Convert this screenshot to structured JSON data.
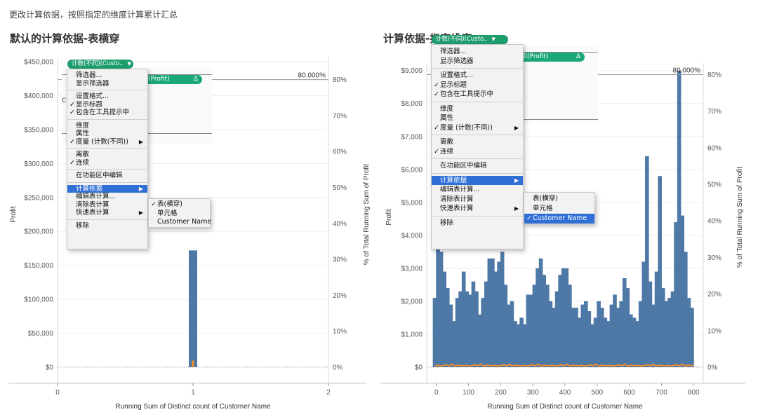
{
  "page": {
    "caption": "更改计算依据，按照指定的维度计算累计汇总",
    "left_title": "默认的计算依据-表横穿",
    "right_title": "计算依据-指定维度"
  },
  "colors": {
    "bar": "#4e79a7",
    "line": "#f28e2b",
    "pill": "#1e9d6d",
    "highlight": "#2f6fd6"
  },
  "left_panel": {
    "pill_label": "计数(不同)(Custo..",
    "pill2_label": "和(Profit)",
    "pill2_delta": "Δ",
    "partial_text": "CO",
    "ref_line_label": "80.000%",
    "menu": {
      "items": [
        {
          "label": "筛选器...",
          "checked": false,
          "submenu": false
        },
        {
          "label": "显示筛选器",
          "checked": false,
          "submenu": false
        },
        {
          "label": "设置格式...",
          "checked": false,
          "submenu": false
        },
        {
          "label": "显示标题",
          "checked": true,
          "submenu": false
        },
        {
          "label": "包含在工具提示中",
          "checked": true,
          "submenu": false
        },
        {
          "label": "维度",
          "checked": false,
          "submenu": false
        },
        {
          "label": "属性",
          "checked": false,
          "submenu": false
        },
        {
          "label": "度量 (计数(不同))",
          "checked": true,
          "submenu": true
        },
        {
          "label": "离散",
          "checked": false,
          "submenu": false
        },
        {
          "label": "连续",
          "checked": true,
          "submenu": false
        },
        {
          "label": "在功能区中编辑",
          "checked": false,
          "submenu": false
        },
        {
          "label": "计算依据",
          "checked": false,
          "submenu": true,
          "highlighted": true
        },
        {
          "label": "编辑表计算...",
          "checked": false,
          "submenu": false
        },
        {
          "label": "清除表计算",
          "checked": false,
          "submenu": false
        },
        {
          "label": "快速表计算",
          "checked": false,
          "submenu": true
        },
        {
          "label": "移除",
          "checked": false,
          "submenu": false
        }
      ],
      "submenu": [
        {
          "label": "表(横穿)",
          "checked": true,
          "highlighted": false
        },
        {
          "label": "单元格",
          "checked": false,
          "highlighted": false
        },
        {
          "label": "Customer Name",
          "checked": false,
          "highlighted": false
        }
      ]
    }
  },
  "right_panel": {
    "pill_label": "计数(不同)(Custo..",
    "pill2_label": "和(Profit)",
    "pill2_delta": "Δ",
    "ref_line_label": "80.000%",
    "menu": {
      "items": [
        {
          "label": "筛选器...",
          "checked": false,
          "submenu": false
        },
        {
          "label": "显示筛选器",
          "checked": false,
          "submenu": false
        },
        {
          "label": "设置格式...",
          "checked": false,
          "submenu": false
        },
        {
          "label": "显示标题",
          "checked": true,
          "submenu": false
        },
        {
          "label": "包含在工具提示中",
          "checked": true,
          "submenu": false
        },
        {
          "label": "维度",
          "checked": false,
          "submenu": false
        },
        {
          "label": "属性",
          "checked": false,
          "submenu": false
        },
        {
          "label": "度量 (计数(不同))",
          "checked": true,
          "submenu": true
        },
        {
          "label": "离散",
          "checked": false,
          "submenu": false
        },
        {
          "label": "连续",
          "checked": true,
          "submenu": false
        },
        {
          "label": "在功能区中编辑",
          "checked": false,
          "submenu": false
        },
        {
          "label": "计算依据",
          "checked": false,
          "submenu": true,
          "highlighted": true
        },
        {
          "label": "编辑表计算...",
          "checked": false,
          "submenu": false
        },
        {
          "label": "清除表计算",
          "checked": false,
          "submenu": false
        },
        {
          "label": "快速表计算",
          "checked": false,
          "submenu": true
        },
        {
          "label": "移除",
          "checked": false,
          "submenu": false
        }
      ],
      "submenu": [
        {
          "label": "表(横穿)",
          "checked": false,
          "highlighted": false
        },
        {
          "label": "单元格",
          "checked": false,
          "highlighted": false
        },
        {
          "label": "Customer Name",
          "checked": true,
          "highlighted": true
        }
      ]
    }
  },
  "chart_data": [
    {
      "type": "bar",
      "title": "默认的计算依据-表横穿",
      "xlabel": "Running Sum of Distinct count of Customer Name",
      "ylabel": "Profit",
      "y2label": "% of Total Running Sum of Profit",
      "xlim": [
        0,
        2
      ],
      "ylim": [
        0,
        450000
      ],
      "y2lim": [
        0,
        0.85
      ],
      "x_ticks": [
        "0",
        "1",
        "2"
      ],
      "y_ticks": [
        "$450,000",
        "$400,000",
        "$350,000",
        "$300,000",
        "$250,000",
        "$200,000",
        "$150,000",
        "$100,000",
        "$50,000",
        "$0"
      ],
      "y_tick_values": [
        450000,
        400000,
        350000,
        300000,
        250000,
        200000,
        150000,
        100000,
        50000,
        0
      ],
      "y2_ticks": [
        "80%",
        "70%",
        "60%",
        "50%",
        "40%",
        "30%",
        "20%",
        "10%",
        "0%"
      ],
      "y2_tick_values": [
        0.8,
        0.7,
        0.6,
        0.5,
        0.4,
        0.3,
        0.2,
        0.1,
        0
      ],
      "reference_line": {
        "value": 0.8,
        "label": "80.000%"
      },
      "series": [
        {
          "name": "Profit",
          "x": [
            1
          ],
          "values": [
            172000
          ]
        },
        {
          "name": "% of Total Running Sum of Profit",
          "x": [
            1
          ],
          "values": [
            10000
          ]
        }
      ]
    },
    {
      "type": "bar",
      "title": "计算依据-指定维度",
      "xlabel": "Running Sum of Distinct count of Customer Name",
      "ylabel": "Profit",
      "y2label": "% of Total Running Sum of Profit",
      "xlim": [
        -30,
        830
      ],
      "ylim": [
        0,
        9100
      ],
      "y2lim": [
        0,
        0.82
      ],
      "x_ticks": [
        "0",
        "100",
        "200",
        "300",
        "400",
        "500",
        "600",
        "700",
        "800"
      ],
      "x_tick_values": [
        0,
        100,
        200,
        300,
        400,
        500,
        600,
        700,
        800
      ],
      "y_ticks": [
        "$9,000",
        "$8,000",
        "$7,000",
        "$6,000",
        "$5,000",
        "$4,000",
        "$3,000",
        "$2,000",
        "$1,000",
        "$0"
      ],
      "y_tick_values": [
        9000,
        8000,
        7000,
        6000,
        5000,
        4000,
        3000,
        2000,
        1000,
        0
      ],
      "y2_ticks": [
        "80%",
        "70%",
        "60%",
        "50%",
        "40%",
        "30%",
        "20%",
        "10%",
        "0%"
      ],
      "y2_tick_values": [
        0.8,
        0.7,
        0.6,
        0.5,
        0.4,
        0.3,
        0.2,
        0.1,
        0
      ],
      "reference_line": {
        "value": 0.8,
        "label": "80.000%"
      },
      "series": [
        {
          "name": "Profit",
          "x": [
            -5,
            5,
            15,
            25,
            35,
            45,
            55,
            65,
            75,
            85,
            95,
            105,
            115,
            125,
            135,
            145,
            155,
            165,
            175,
            185,
            195,
            205,
            215,
            225,
            235,
            245,
            255,
            265,
            275,
            285,
            295,
            305,
            315,
            325,
            335,
            345,
            355,
            365,
            375,
            385,
            395,
            405,
            415,
            425,
            435,
            445,
            455,
            465,
            475,
            485,
            495,
            505,
            515,
            525,
            535,
            545,
            555,
            565,
            575,
            585,
            595,
            605,
            615,
            625,
            635,
            645,
            655,
            665,
            675,
            685,
            695,
            705,
            715,
            725,
            735,
            745,
            755,
            765,
            775,
            785,
            795
          ],
          "values": [
            2100,
            4100,
            3500,
            2900,
            2400,
            1900,
            1400,
            2100,
            2300,
            2900,
            2300,
            2200,
            2600,
            2300,
            1600,
            2100,
            2600,
            3300,
            3300,
            2900,
            3200,
            3500,
            2500,
            1900,
            2000,
            1400,
            1300,
            1500,
            1300,
            2200,
            2200,
            2500,
            3000,
            3300,
            2800,
            2500,
            2000,
            1800,
            2300,
            2800,
            3000,
            3000,
            2500,
            1800,
            1800,
            1500,
            1900,
            2000,
            1700,
            1300,
            1500,
            2000,
            1800,
            1500,
            1400,
            1900,
            2200,
            1800,
            2000,
            2700,
            2400,
            1600,
            1500,
            1400,
            2000,
            3200,
            6400,
            2600,
            1900,
            2900,
            5800,
            2400,
            2000,
            2100,
            2300,
            4400,
            9000,
            4600,
            3500,
            2100,
            1800
          ]
        },
        {
          "name": "% of Total Running Sum of Profit",
          "values": [
            40,
            60,
            30,
            50,
            70,
            40,
            90,
            30,
            60,
            50
          ]
        }
      ]
    }
  ]
}
